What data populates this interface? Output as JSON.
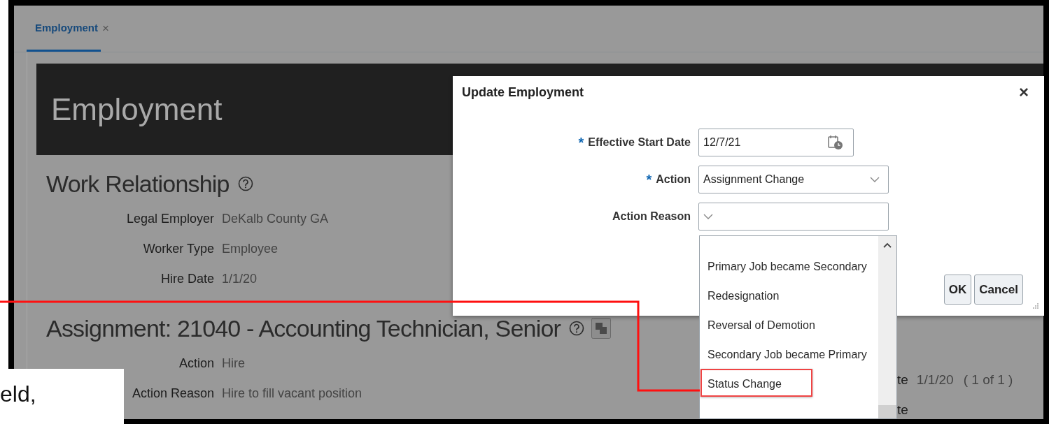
{
  "tab": {
    "label": "Employment",
    "close": "×",
    "selected": true
  },
  "page": {
    "title": "Employment",
    "sections": [
      {
        "heading": "Work Relationship",
        "has_copy_icon": false,
        "fields": [
          {
            "label": "Legal Employer",
            "value": "DeKalb County GA"
          },
          {
            "label": "Worker Type",
            "value": "Employee"
          },
          {
            "label": "Hire Date",
            "value": "1/1/20"
          }
        ]
      },
      {
        "heading": "Assignment: 21040 - Accounting Technician, Senior",
        "has_copy_icon": true,
        "fields": [
          {
            "label": "Action",
            "value": "Hire"
          },
          {
            "label": "Action Reason",
            "value": "Hire to fill vacant position"
          }
        ]
      }
    ],
    "side_fields": [
      {
        "label": "te",
        "value": "1/1/20",
        "pager": "( 1 of 1 )"
      },
      {
        "label": "te"
      }
    ]
  },
  "dialog": {
    "title": "Update Employment",
    "close": "×",
    "fields": [
      {
        "label": "Effective Start Date",
        "marker": "*",
        "kind": "date",
        "value": "12/7/21"
      },
      {
        "label": "Action",
        "marker": "*",
        "kind": "select",
        "value": "Assignment Change"
      },
      {
        "label": "Action Reason",
        "kind": "select"
      }
    ],
    "buttons": [
      {
        "label": "OK"
      },
      {
        "label": "Cancel"
      }
    ]
  },
  "dropdown": {
    "options": [
      {
        "label": "Primary Job became Secondary",
        "selected": false,
        "highlighted": false
      },
      {
        "label": "Redesignation",
        "selected": false,
        "highlighted": false
      },
      {
        "label": "Reversal of Demotion",
        "selected": false,
        "highlighted": false
      },
      {
        "label": "Secondary Job became Primary",
        "selected": false,
        "highlighted": false
      },
      {
        "label": "Status Change",
        "selected": false,
        "highlighted": true
      }
    ]
  },
  "callout": {
    "text": "eld,"
  }
}
